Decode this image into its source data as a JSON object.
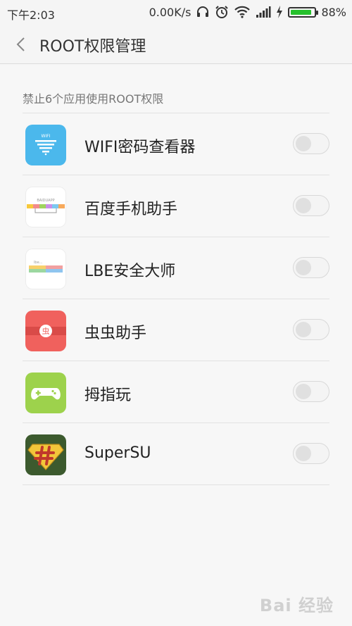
{
  "status_bar": {
    "time": "下午2:03",
    "net_speed": "0.00K/s",
    "battery_percent": "88%",
    "battery_level": 0.88,
    "icons": [
      "headset-icon",
      "alarm-icon",
      "wifi-icon",
      "signal-icon",
      "charging-icon",
      "battery-icon"
    ]
  },
  "title_bar": {
    "title": "ROOT权限管理",
    "back_icon": "chevron-left-icon"
  },
  "section_label": "禁止6个应用使用ROOT权限",
  "apps": [
    {
      "name": "WIFI密码查看器",
      "icon": "wifi-password-viewer-icon",
      "enabled": false,
      "icon_color": "#4bb8ec"
    },
    {
      "name": "百度手机助手",
      "icon": "baidu-assistant-icon",
      "enabled": false,
      "icon_color": "#ffffff"
    },
    {
      "name": "LBE安全大师",
      "icon": "lbe-security-icon",
      "enabled": false,
      "icon_color": "#ffffff"
    },
    {
      "name": "虫虫助手",
      "icon": "chongchong-assistant-icon",
      "enabled": false,
      "icon_color": "#f0615d"
    },
    {
      "name": "拇指玩",
      "icon": "muzhiwan-gamepad-icon",
      "enabled": false,
      "icon_color": "#9dd24c"
    },
    {
      "name": "SuperSU",
      "icon": "supersu-icon",
      "enabled": false,
      "icon_color": "#3c5a2e"
    }
  ],
  "watermark_text": "Bai 经验"
}
